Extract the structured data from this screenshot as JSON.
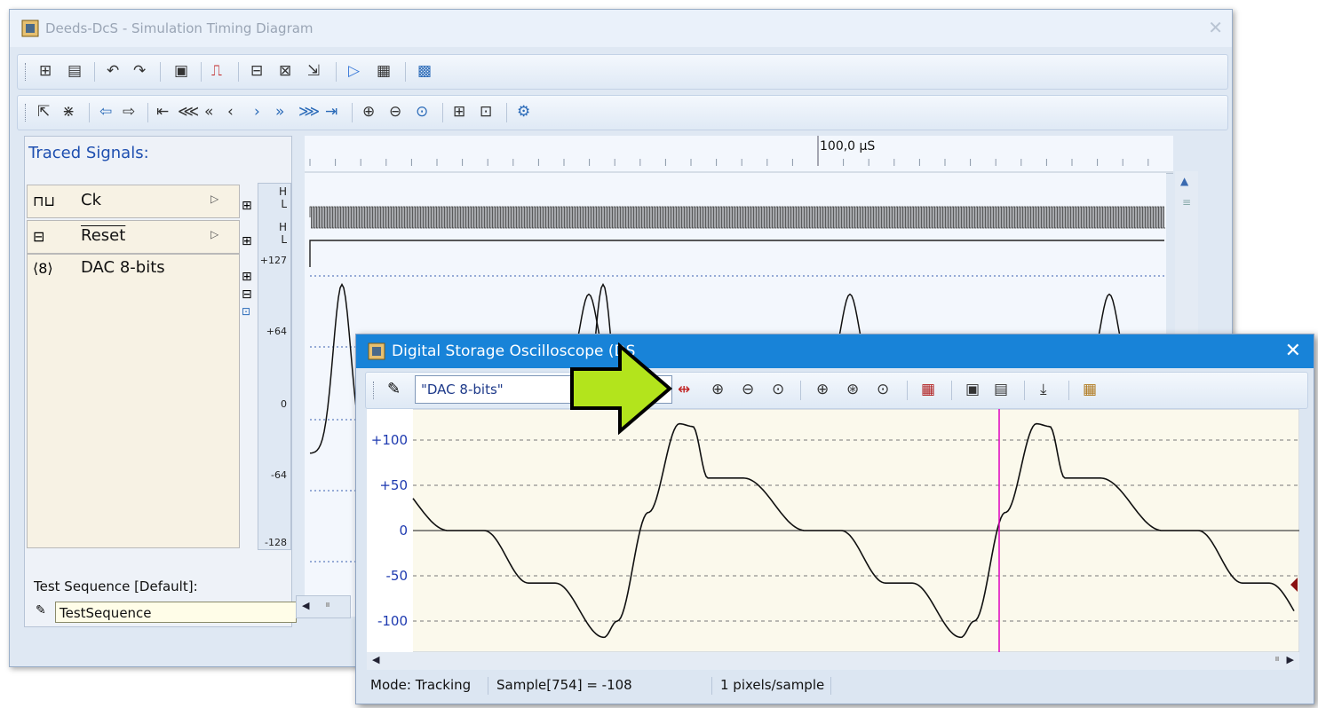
{
  "main_window": {
    "title": "Deeds-DcS  -  Simulation Timing Diagram",
    "close": "✕",
    "toolbar_row1_icons": [
      "signals-icon",
      "doc-icon",
      "undo-icon",
      "redo-icon",
      "clipboard-icon",
      "step-icon",
      "add-signal-icon",
      "edit-signal-icon",
      "pointer-icon",
      "play-icon",
      "memory-icon",
      "grid-icon"
    ],
    "toolbar_row2_icons": [
      "pointer-icon",
      "zoom-signal-icon",
      "prev-edge-icon",
      "next-edge-icon",
      "start-icon",
      "fast-back-icon",
      "back-icon",
      "step-back-icon",
      "step-forward-icon",
      "forward-icon",
      "fast-forward-icon",
      "end-icon",
      "zoom-in-icon",
      "zoom-out-icon",
      "zoom-fit-icon",
      "export-icon",
      "print-icon",
      "settings-icon"
    ],
    "traced_signals_title": "Traced Signals:",
    "signals": [
      {
        "name": "Ck",
        "icon": "clock-icon",
        "hl_top": "H",
        "hl_bottom": "L"
      },
      {
        "name": "Reset",
        "icon": "reset-icon",
        "hl_top": "H",
        "hl_bottom": "L"
      },
      {
        "name": "DAC 8-bits",
        "icon": "dac-icon"
      }
    ],
    "dac_scale": [
      "+127",
      "+64",
      "0",
      "-64",
      "-128"
    ],
    "ruler_label": "100,0 µS",
    "test_sequence_label": "Test Sequence [Default]:",
    "test_sequence_value": "TestSequence",
    "plus_label": "+"
  },
  "dso_window": {
    "title": "Digital Storage Oscilloscope (DSO)",
    "title_visible": "Digital Storage Oscilloscope (DS",
    "close": "✕",
    "channel": "\"DAC 8-bits\"",
    "y_axis": [
      "+100",
      "+50",
      "0",
      "-50",
      "-100"
    ],
    "status": {
      "mode": "Mode: Tracking",
      "sample": "Sample[754] = -108",
      "scale": "1 pixels/sample"
    },
    "cursor_color": "#e000c0",
    "toolbar_icons": [
      "cursor-measure-icon",
      "zoom-in-icon",
      "zoom-out-icon",
      "zoom-fit-icon",
      "time-zoom-in-icon",
      "time-zoom-all-icon",
      "time-zoom-out-icon",
      "memory-icon",
      "copy-icon",
      "save-icon",
      "download-icon",
      "grid-icon"
    ]
  },
  "arrow_color": "#b3e41c"
}
